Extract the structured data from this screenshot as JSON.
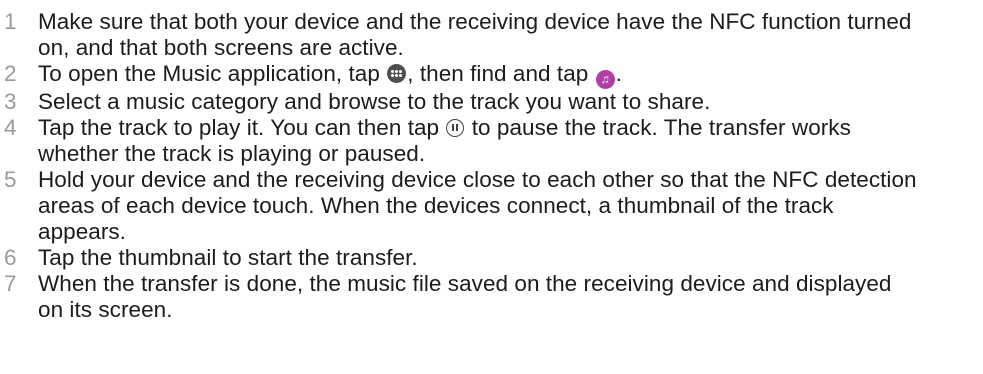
{
  "steps": [
    {
      "number": "1",
      "text": "Make sure that both your device and the receiving device have the NFC function turned on, and that both screens are active."
    },
    {
      "number": "2",
      "text_before_apps": "To open the Music application, tap",
      "text_between": ", then find and tap",
      "text_after_music": ".",
      "icons": [
        "apps-icon",
        "music-icon"
      ]
    },
    {
      "number": "3",
      "text": "Select a music category and browse to the track you want to share."
    },
    {
      "number": "4",
      "text_before_pause": "Tap the track to play it. You can then tap",
      "text_after_pause": "to pause the track. The transfer works whether the track is playing or paused.",
      "icons": [
        "pause-icon"
      ]
    },
    {
      "number": "5",
      "text": "Hold your device and the receiving device close to each other so that the NFC detection areas of each device touch. When the devices connect, a thumbnail of the track appears."
    },
    {
      "number": "6",
      "text": "Tap the thumbnail to start the transfer."
    },
    {
      "number": "7",
      "text": "When the transfer is done, the music file saved on the receiving device and displayed on its screen."
    }
  ]
}
